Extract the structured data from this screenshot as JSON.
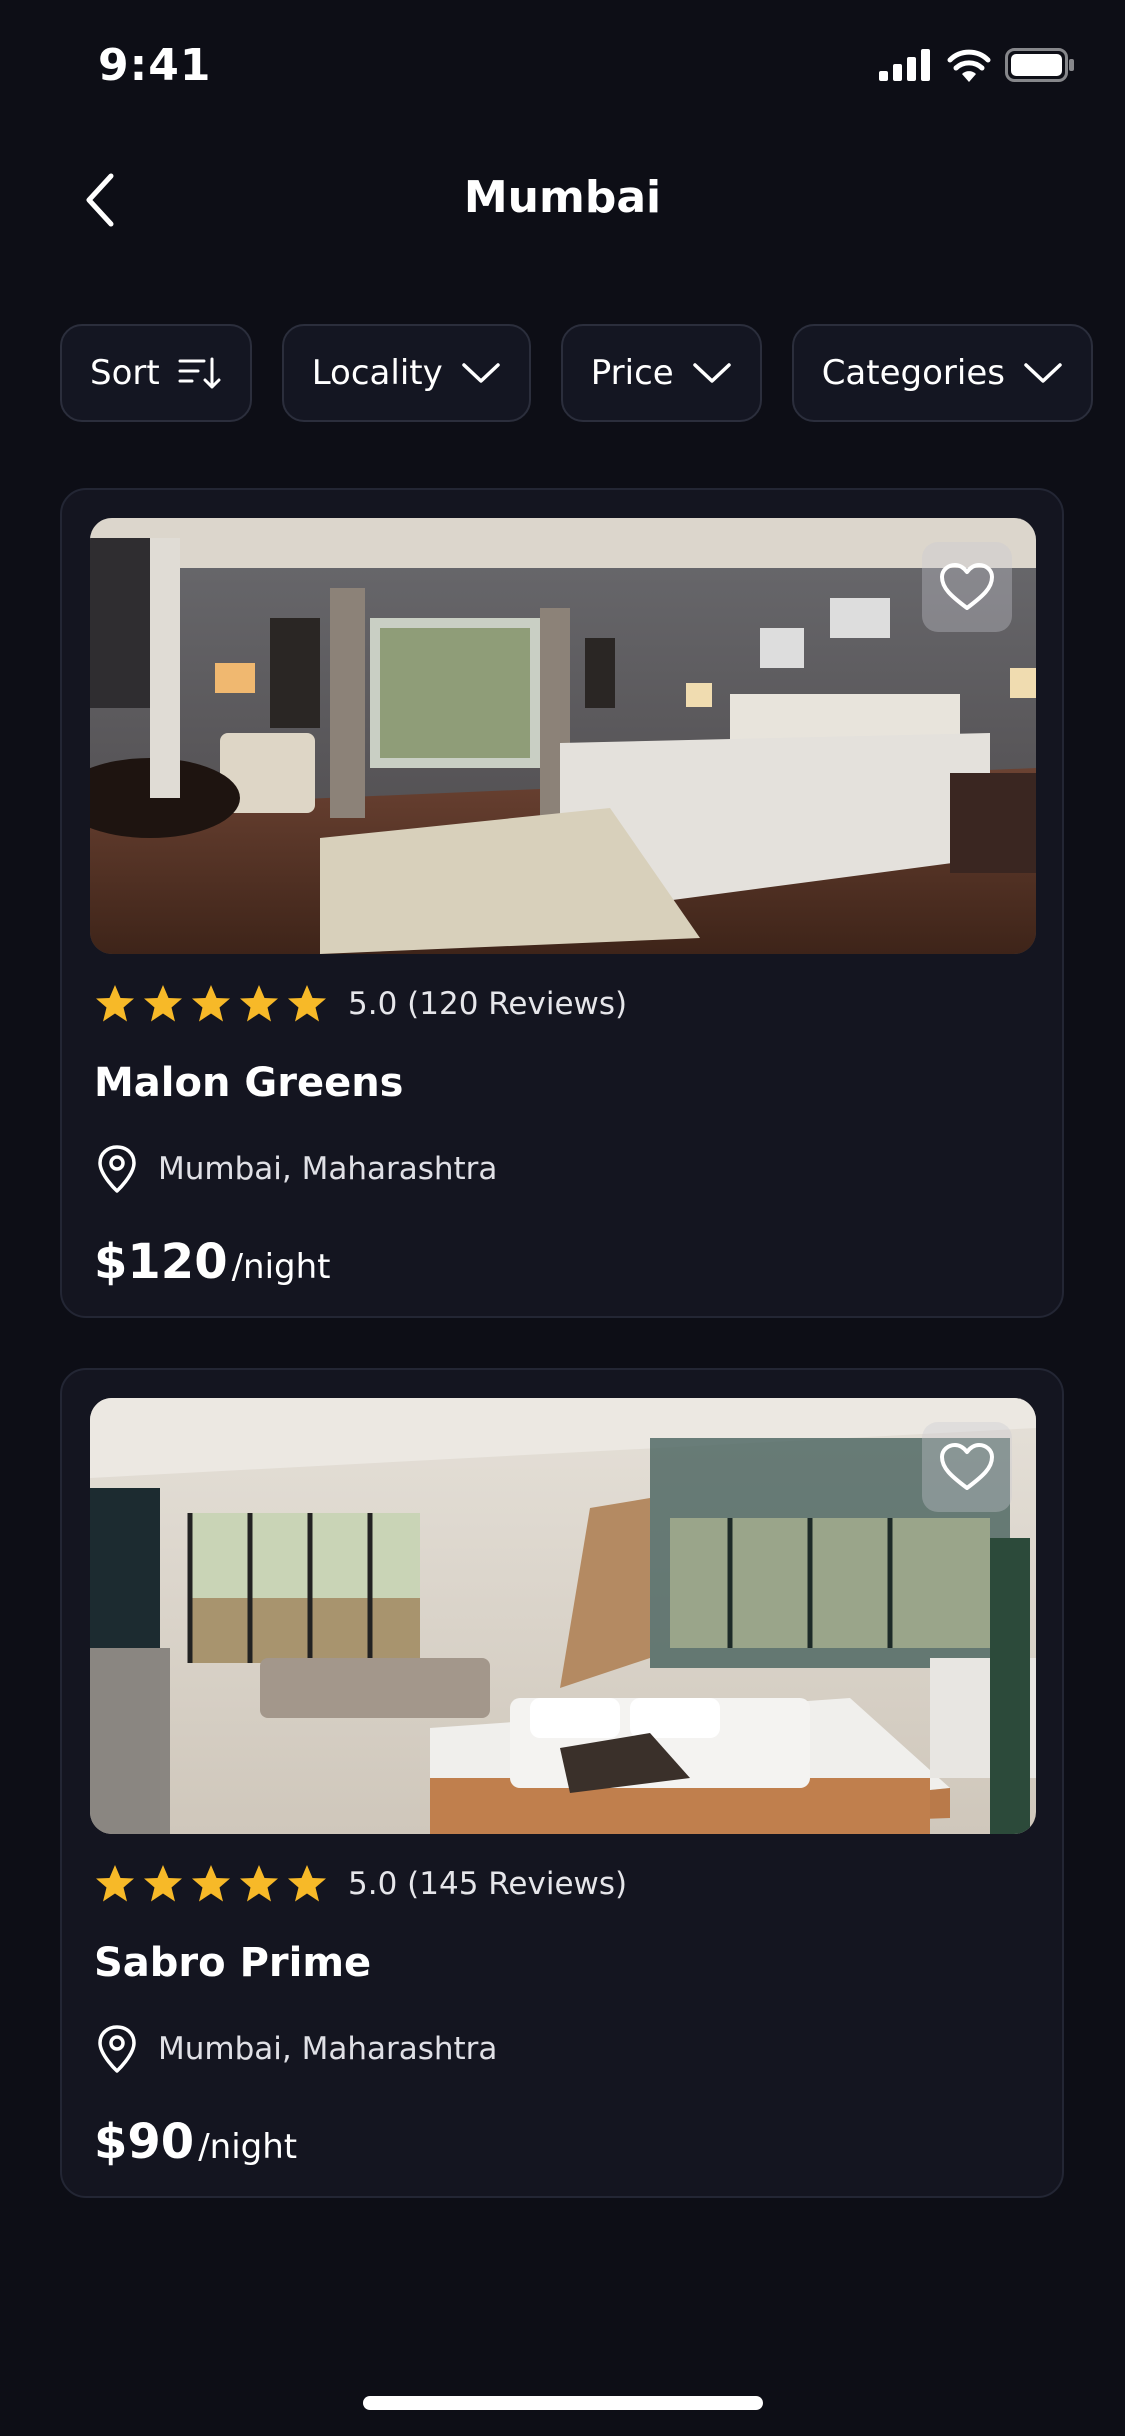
{
  "status": {
    "time": "9:41"
  },
  "nav": {
    "title": "Mumbai"
  },
  "filters": [
    {
      "label": "Sort",
      "icon": "sort-icon"
    },
    {
      "label": "Locality",
      "icon": "chevron-down-icon"
    },
    {
      "label": "Price",
      "icon": "chevron-down-icon"
    },
    {
      "label": "Categories",
      "icon": "chevron-down-icon"
    }
  ],
  "listings": [
    {
      "name": "Malon Greens",
      "rating_text": "5.0 (120 Reviews)",
      "stars": 5,
      "location": "Mumbai, Maharashtra",
      "price": "$120",
      "per": "/night"
    },
    {
      "name": "Sabro Prime",
      "rating_text": "5.0 (145 Reviews)",
      "stars": 5,
      "location": "Mumbai, Maharashtra",
      "price": "$90",
      "per": "/night"
    }
  ],
  "colors": {
    "background": "#0d0e16",
    "card": "#141520",
    "star": "#f7b928",
    "text": "#ffffff"
  }
}
